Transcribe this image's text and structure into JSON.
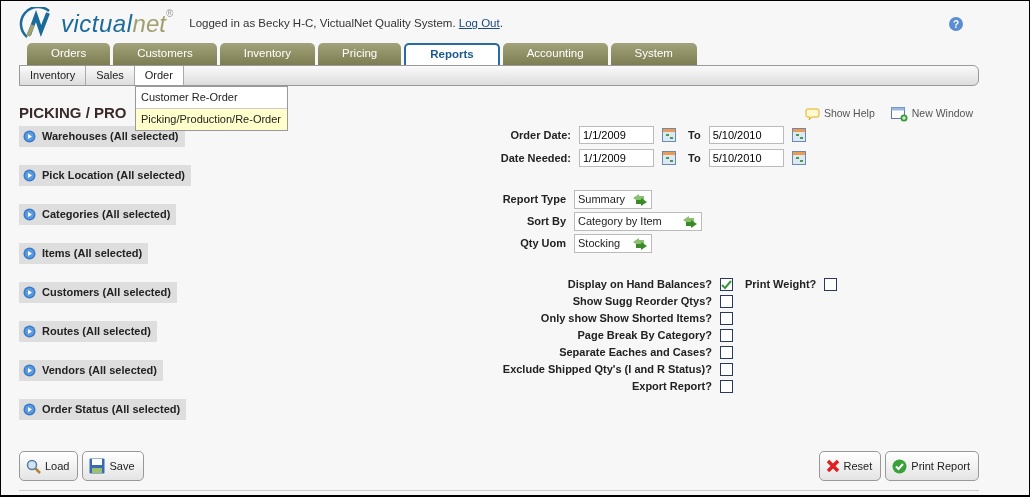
{
  "header": {
    "logo": {
      "first": "victual",
      "second": "net",
      "mark": "®"
    },
    "login_text": "Logged in as Becky H-C, VictualNet Quality System.",
    "logout_link": "Log Out",
    "login_end": ".",
    "help_glyph": "?"
  },
  "tabs": [
    {
      "label": "Orders",
      "selected": false
    },
    {
      "label": "Customers",
      "selected": false
    },
    {
      "label": "Inventory",
      "selected": false
    },
    {
      "label": "Pricing",
      "selected": false
    },
    {
      "label": "Reports",
      "selected": true
    },
    {
      "label": "Accounting",
      "selected": false
    },
    {
      "label": "System",
      "selected": false
    }
  ],
  "subtabs": [
    {
      "label": "Inventory",
      "selected": false
    },
    {
      "label": "Sales",
      "selected": false
    },
    {
      "label": "Order",
      "selected": true
    }
  ],
  "dropdown": [
    {
      "label": "Customer Re-Order",
      "selected": false
    },
    {
      "label": "Picking/Production/Re-Order",
      "selected": true
    }
  ],
  "page_title": "PICKING / PRO",
  "toolbar": [
    {
      "kind": "help",
      "label": "Show Help"
    },
    {
      "kind": "window",
      "label": "New Window"
    }
  ],
  "filters": [
    "Warehouses (All selected)",
    "Pick Location (All selected)",
    "Categories (All selected)",
    "Items (All selected)",
    "Customers (All selected)",
    "Routes (All selected)",
    "Vendors (All selected)",
    "Order Status (All selected)"
  ],
  "date_rows": [
    {
      "label": "Order Date:",
      "from": "1/1/2009",
      "to_label": "To",
      "to": "5/10/2010"
    },
    {
      "label": "Date Needed:",
      "from": "1/1/2009",
      "to_label": "To",
      "to": "5/10/2010"
    }
  ],
  "selects": [
    {
      "label": "Report Type",
      "value": "Summary",
      "wide": false
    },
    {
      "label": "Sort By",
      "value": "Category by Item",
      "wide": true
    },
    {
      "label": "Qty Uom",
      "value": "Stocking",
      "wide": false
    }
  ],
  "options": [
    {
      "label": "Display on Hand Balances?",
      "checked": true,
      "extra": {
        "label": "Print Weight?",
        "checked": false
      }
    },
    {
      "label": "Show Sugg Reorder Qtys?",
      "checked": false
    },
    {
      "label": "Only show Show Shorted Items?",
      "checked": false
    },
    {
      "label": "Page Break By Category?",
      "checked": false
    },
    {
      "label": "Separate Eaches and Cases?",
      "checked": false
    },
    {
      "label": "Exclude Shipped Qty's (I and R Status)?",
      "checked": false
    },
    {
      "label": "Export Report?",
      "checked": false
    }
  ],
  "left_buttons": [
    {
      "kind": "load",
      "label": "Load"
    },
    {
      "kind": "save",
      "label": "Save"
    }
  ],
  "right_buttons": [
    {
      "kind": "reset",
      "label": "Reset"
    },
    {
      "kind": "print",
      "label": "Print Report"
    }
  ]
}
